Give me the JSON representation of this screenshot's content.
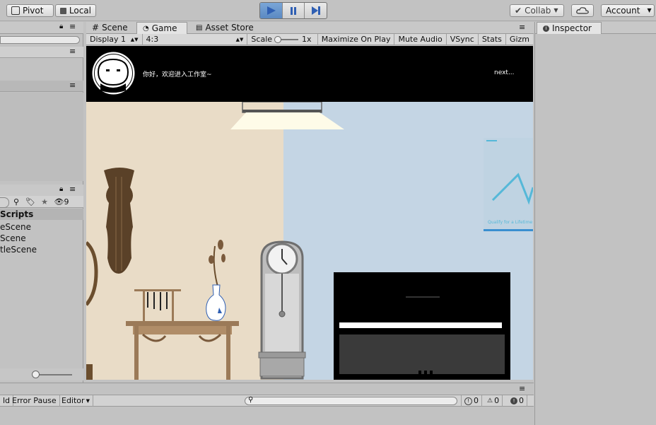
{
  "toolbar": {
    "pivot_label": "Pivot",
    "local_label": "Local",
    "collab_label": "Collab",
    "account_label": "Account",
    "colors": {
      "play_active": "#5b89c2",
      "icon_blue": "#2f5fb3"
    }
  },
  "scene_panel": {
    "tabs": [
      {
        "label": "Scene",
        "icon": "grid-icon"
      },
      {
        "label": "Game",
        "icon": "game-controller-icon"
      },
      {
        "label": "Asset Store",
        "icon": "store-icon"
      }
    ],
    "game_toolbar": {
      "display": "Display 1",
      "aspect": "4:3",
      "scale_label": "Scale",
      "scale_value": "1x",
      "maximize": "Maximize On Play",
      "mute": "Mute Audio",
      "vsync": "VSync",
      "stats": "Stats",
      "gizmos": "Gizm"
    }
  },
  "inspector": {
    "tab_label": "Inspector"
  },
  "project_panel": {
    "filter_count": "9",
    "folder_label": "Scripts",
    "items": [
      "eScene",
      "Scene",
      "tleScene"
    ]
  },
  "game_view": {
    "dialog_text": "你好，欢迎进入工作室~",
    "next_label": "next...",
    "colors": {
      "wall_left": "#e9dcc7",
      "wall_right": "#c4d5e4",
      "dialog_bg": "#000000",
      "wood": "#5a4128",
      "table": "#9b7a58",
      "clock": "#8a8a8a",
      "piano": "#000000",
      "lamp": "#fefbe8",
      "poster_line": "#55b8d8"
    },
    "poster_caption": "Qualify for a Lifetime ..."
  },
  "console_bar": {
    "clear_partial": "ld",
    "error_pause": "Error Pause",
    "editor": "Editor",
    "counts": {
      "log": "0",
      "warning": "0",
      "error": "0"
    }
  }
}
